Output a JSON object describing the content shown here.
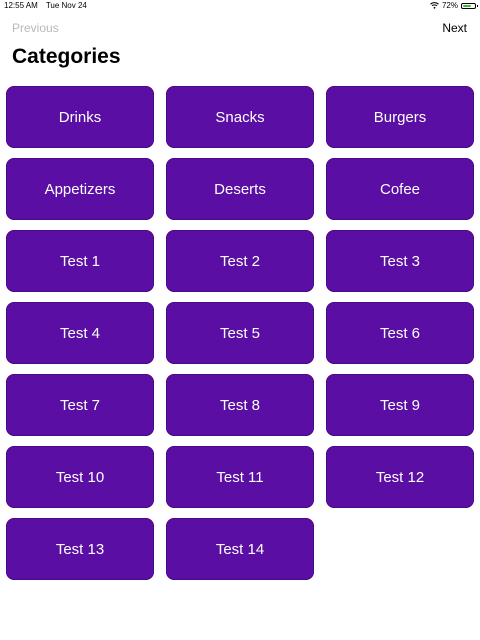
{
  "status_bar": {
    "time": "12:55 AM",
    "date": "Tue Nov 24",
    "battery": "72%",
    "battery_level": 0.72
  },
  "nav": {
    "previous_label": "Previous",
    "next_label": "Next"
  },
  "page_title": "Categories",
  "categories": [
    "Drinks",
    "Snacks",
    "Burgers",
    "Appetizers",
    "Deserts",
    "Cofee",
    "Test 1",
    "Test 2",
    "Test 3",
    "Test 4",
    "Test 5",
    "Test 6",
    "Test 7",
    "Test 8",
    "Test 9",
    "Test 10",
    "Test 11",
    "Test 12",
    "Test 13",
    "Test 14"
  ]
}
